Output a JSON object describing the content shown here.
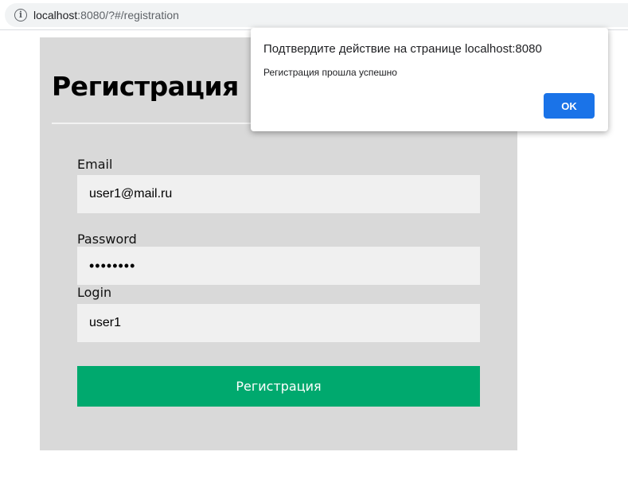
{
  "browser": {
    "url_host": "localhost",
    "url_rest": ":8080/?#/registration"
  },
  "form": {
    "title": "Регистрация",
    "email": {
      "label": "Email",
      "value": "user1@mail.ru"
    },
    "password": {
      "label": "Password",
      "value": "••••••••"
    },
    "login": {
      "label": "Login",
      "value": "user1"
    },
    "submit_label": "Регистрация"
  },
  "dialog": {
    "title": "Подтвердите действие на странице localhost:8080",
    "message": "Регистрация прошла успешно",
    "ok_label": "OK"
  },
  "colors": {
    "card_bg": "#d9d9d9",
    "submit_bg": "#00a96e",
    "dialog_ok_bg": "#1a73e8"
  }
}
